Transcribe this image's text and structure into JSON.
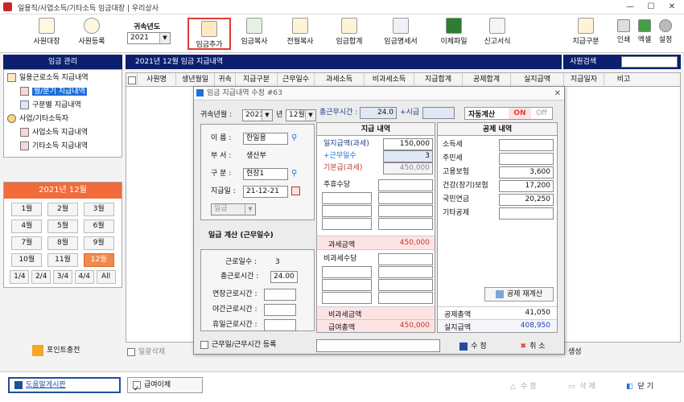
{
  "window": {
    "title": "일용직/사업소득/기타소득 임금대장 | 우리상사",
    "minimize": "—",
    "maximize": "☐",
    "close": "✕"
  },
  "toolbar": {
    "employee_ledger": "사원대장",
    "employee_register": "사원등록",
    "year_label": "귀속년도",
    "year_value": "2021",
    "wage_add": "임금추가",
    "wage_copy": "임금복사",
    "prev_month_copy": "전월복사",
    "wage_total": "임금합계",
    "payslip": "임금명세서",
    "transfer_file": "이체파일",
    "report_form": "신고서식",
    "wage_category": "지급구분",
    "print": "인쇄",
    "excel": "엑셀",
    "settings": "설정"
  },
  "sidebar": {
    "header": "임금 관리",
    "tree": [
      {
        "label": "일용근로소득 지급내역",
        "level": 0
      },
      {
        "label": "월/분기 지급내역",
        "level": 1,
        "selected": true
      },
      {
        "label": "구분별 지급내역",
        "level": 1
      },
      {
        "label": "사업/기타소득자",
        "level": 0
      },
      {
        "label": "사업소득 지급내역",
        "level": 1
      },
      {
        "label": "기타소득 지급내역",
        "level": 1
      }
    ],
    "calendar_title": "2021년 12월",
    "months": [
      [
        "1월",
        "2월",
        "3월"
      ],
      [
        "4월",
        "5월",
        "6월"
      ],
      [
        "7월",
        "8월",
        "9월"
      ],
      [
        "10월",
        "11월",
        "12월"
      ]
    ],
    "selected_month": "12월",
    "quarters": [
      "1/4",
      "2/4",
      "3/4",
      "4/4",
      "All"
    ],
    "point_charge": "포인트충전"
  },
  "main": {
    "title": "2021년 12월 임금 지급내역",
    "employee_search_label": "사원검색",
    "columns": [
      "",
      "사원명",
      "생년월일",
      "귀속",
      "지급구분",
      "근무일수",
      "과세소득",
      "비과세소득",
      "지급합계",
      "공제합계",
      "실지급액",
      "지급일자",
      "비고"
    ],
    "daily_delete": "일괄삭제",
    "create_label": "생성"
  },
  "dialog": {
    "title": "임금 지급내역 수정 #63",
    "year_label": "귀속년월 :",
    "year": "2021",
    "year_unit": "년",
    "month": "12월",
    "total_hours_label": "총근무시간 :",
    "total_hours": "24.0",
    "plus_wage_label": "+시급",
    "auto_calc_label": "자동계산",
    "on_label": "ON",
    "off_label": "Off",
    "name_label": "이    름 :",
    "name": "한일용",
    "dept_label": "부    서 :",
    "dept": "생산부",
    "type_label": "구    분 :",
    "type": "현장1",
    "pay_date_label": "지급일 :",
    "pay_date": "21-12-21",
    "wage_type": "일급",
    "calc_title": "일급 계산 (근무일수)",
    "work_days_label": "근로일수 :",
    "work_days": "3",
    "total_work_label": "총근로시간 :",
    "total_work": "24.00",
    "overtime_label": "연장근로시간 :",
    "night_label": "야간근로시간 :",
    "holiday_label": "휴일근로시간 :",
    "workday_register": "근무일/근무시간 등록",
    "pay_header": "지급 내역",
    "daily_wage_label": "일지급액(과세)",
    "daily_wage": "150,000",
    "work_days_plus_label": "+근무일수",
    "work_days_plus": "3",
    "base_wage_label": "기본급(과세)",
    "base_wage": "450,000",
    "weekly_allowance": "주휴수당",
    "taxable_total_label": "과세금액",
    "taxable_total": "450,000",
    "nontax_allowance": "비과세수당",
    "nontax_total_label": "비과세금액",
    "gross_label": "급여총액",
    "gross": "450,000",
    "deduct_header": "공제 내역",
    "income_tax_label": "소득세",
    "local_tax_label": "주민세",
    "employment_label": "고용보험",
    "employment": "3,600",
    "health_label": "건강(장기)보험",
    "health": "17,200",
    "pension_label": "국민연금",
    "pension": "20,250",
    "other_deduct_label": "기타공제",
    "recalc_button": "공제 재계산",
    "deduct_total_label": "공제총액",
    "deduct_total": "41,050",
    "net_label": "실지급액",
    "net": "408,950",
    "save_button": "수 정",
    "cancel_button": "취 소"
  },
  "bottom": {
    "help_board": "도움말게시판",
    "pay_transfer": "급여이체",
    "edit": "수 정",
    "delete": "삭 제",
    "close": "닫 기"
  },
  "colors": {
    "navy": "#0b1f6e",
    "orange": "#f26b3a",
    "red": "#e53935",
    "blue": "#1e6fd9"
  }
}
